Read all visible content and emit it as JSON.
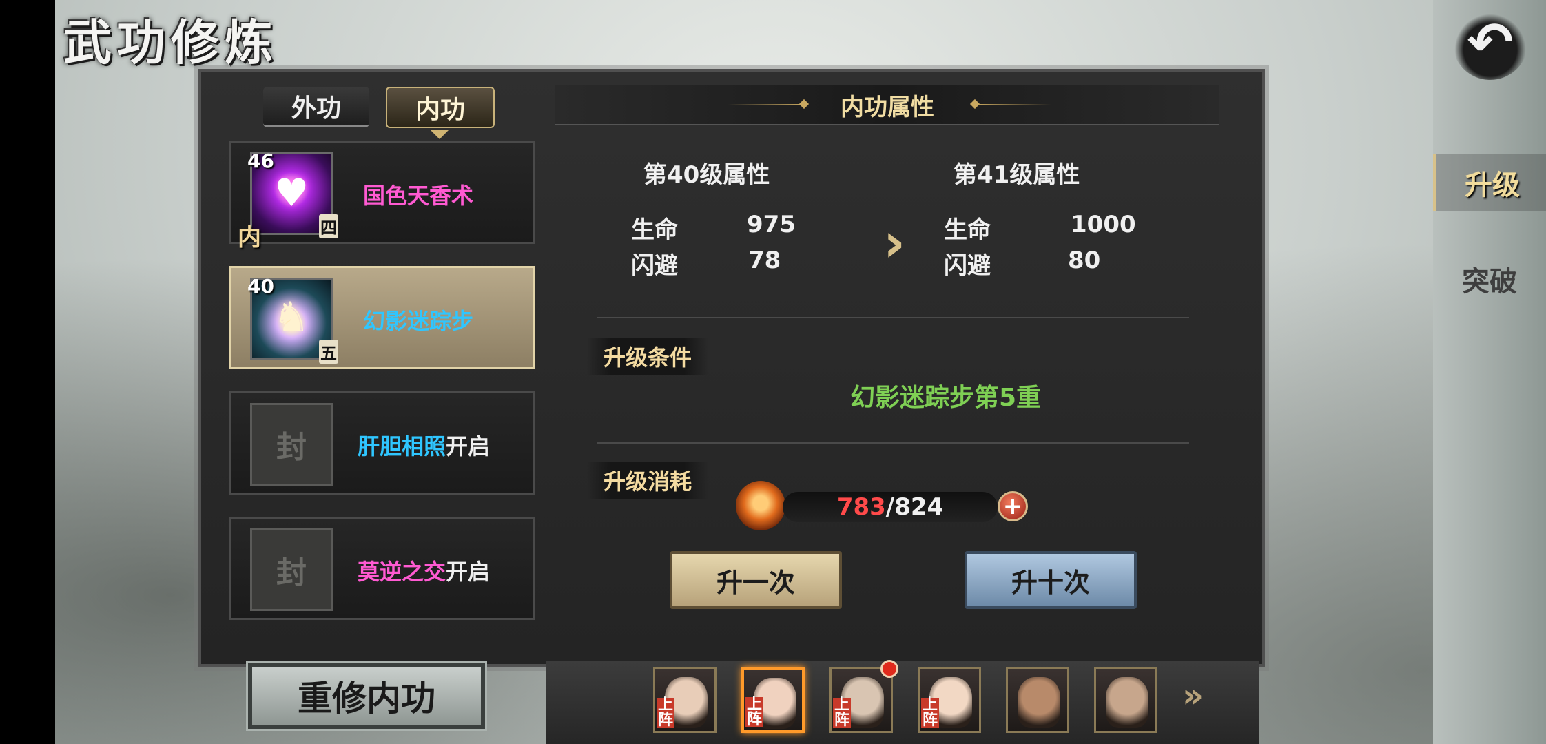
{
  "title": "武功修炼",
  "side_tabs": {
    "upgrade": "升级",
    "breakthrough": "突破"
  },
  "tabs": {
    "outer": "外功",
    "inner": "内功"
  },
  "skills": [
    {
      "level": "46",
      "tier": "四",
      "name": "国色天香术",
      "name_color": "#ff5ad2",
      "inner_mark": "内",
      "icon": "heart-icon"
    },
    {
      "level": "40",
      "tier": "五",
      "name": "幻影迷踪步",
      "name_color": "#2fc6ff",
      "icon": "horse-icon"
    },
    {
      "name": "肝胆相照",
      "name_color": "#2fc6ff",
      "suffix": "开启",
      "lock": "封",
      "icon": "lock-icon"
    },
    {
      "name": "莫逆之交",
      "name_color": "#ff5ad2",
      "suffix": "开启",
      "lock": "封",
      "icon": "lock-icon"
    }
  ],
  "detail": {
    "header": "内功属性",
    "current": {
      "title": "第40级属性",
      "hp_label": "生命",
      "hp_value": "975",
      "dodge_label": "闪避",
      "dodge_value": "78"
    },
    "next": {
      "title": "第41级属性",
      "hp_label": "生命",
      "hp_value": "1000",
      "dodge_label": "闪避",
      "dodge_value": "80"
    },
    "condition_label": "升级条件",
    "condition_text": "幻影迷踪步第5重",
    "cost_label": "升级消耗",
    "cost_current": "783",
    "cost_total": "/824",
    "plus": "+"
  },
  "buttons": {
    "once": "升一次",
    "ten": "升十次",
    "reset": "重修内功"
  },
  "portraits": [
    {
      "name": "portrait-1",
      "deployed": true,
      "deploy_text": "上阵",
      "skin": "#e8cdb8"
    },
    {
      "name": "portrait-2",
      "deployed": true,
      "deploy_text": "上阵",
      "skin": "#f0d2bf",
      "selected": true
    },
    {
      "name": "portrait-3",
      "deployed": true,
      "deploy_text": "上阵",
      "skin": "#d9c5b2",
      "badge": true
    },
    {
      "name": "portrait-4",
      "deployed": true,
      "deploy_text": "上阵",
      "skin": "#f2d8c4"
    },
    {
      "name": "portrait-5",
      "deployed": false,
      "skin": "#b88a6a"
    },
    {
      "name": "portrait-6",
      "deployed": false,
      "skin": "#c7a68c"
    }
  ],
  "colors": {
    "accent_gold": "#f1dda3",
    "condition_green": "#7fd054",
    "cost_red": "#ff4a4a"
  }
}
